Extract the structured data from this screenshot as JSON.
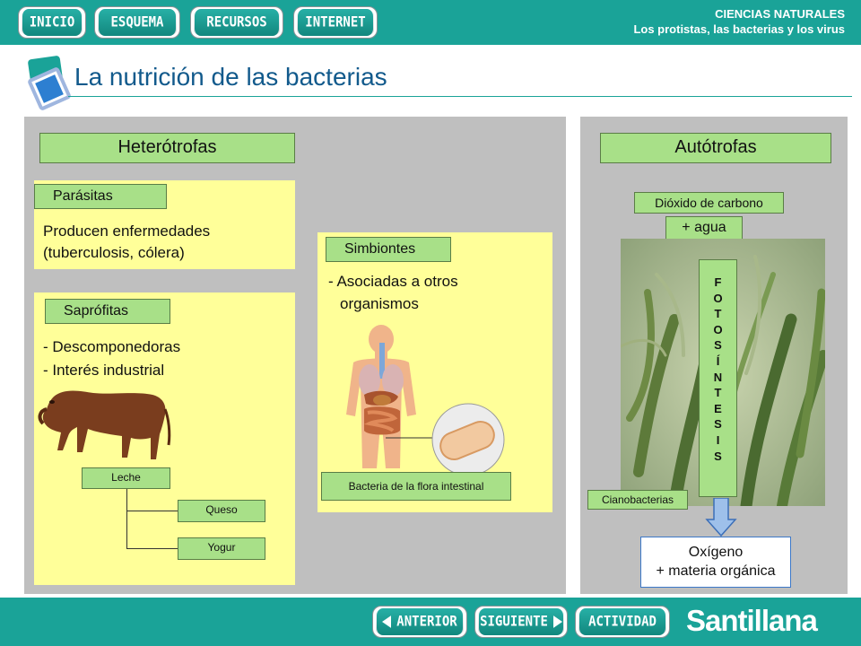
{
  "nav": {
    "inicio": "INICIO",
    "esquema": "ESQUEMA",
    "recursos": "RECURSOS",
    "internet": "INTERNET"
  },
  "subject": {
    "line1": "CIENCIAS NATURALES",
    "line2": "Los protistas, las bacterias y los virus"
  },
  "title": "La nutrición de las bacterias",
  "heterotrofas": {
    "header": "Heterótrofas",
    "parasitas": {
      "label": "Parásitas",
      "line1": "Producen enfermedades",
      "line2": "(tuberculosis, cólera)"
    },
    "saprofitas": {
      "label": "Saprófitas",
      "line1": "- Descomponedoras",
      "line2": "- Interés industrial",
      "leche": "Leche",
      "queso": "Queso",
      "yogur": "Yogur"
    },
    "simbiontes": {
      "label": "Simbiontes",
      "line1": "- Asociadas a otros",
      "line2": "organismos",
      "caption": "Bacteria de la flora intestinal"
    }
  },
  "autotrofas": {
    "header": "Autótrofas",
    "co2": "Dióxido de carbono",
    "agua": "+ agua",
    "fotosintesis": [
      "F",
      "O",
      "T",
      "O",
      "S",
      "Í",
      "N",
      "T",
      "E",
      "S",
      "I",
      "S"
    ],
    "cianobacterias": "Cianobacterias",
    "oxigeno": "Oxígeno",
    "materia": "+ materia orgánica"
  },
  "footer": {
    "anterior": "ANTERIOR",
    "siguiente": "SIGUIENTE",
    "actividad": "ACTIVIDAD",
    "brand": "Santillana"
  },
  "colors": {
    "teal": "#1aa398",
    "green_label": "#a8e088",
    "yellow_panel": "#ffff99",
    "panel_gray": "#bfbfbf"
  }
}
